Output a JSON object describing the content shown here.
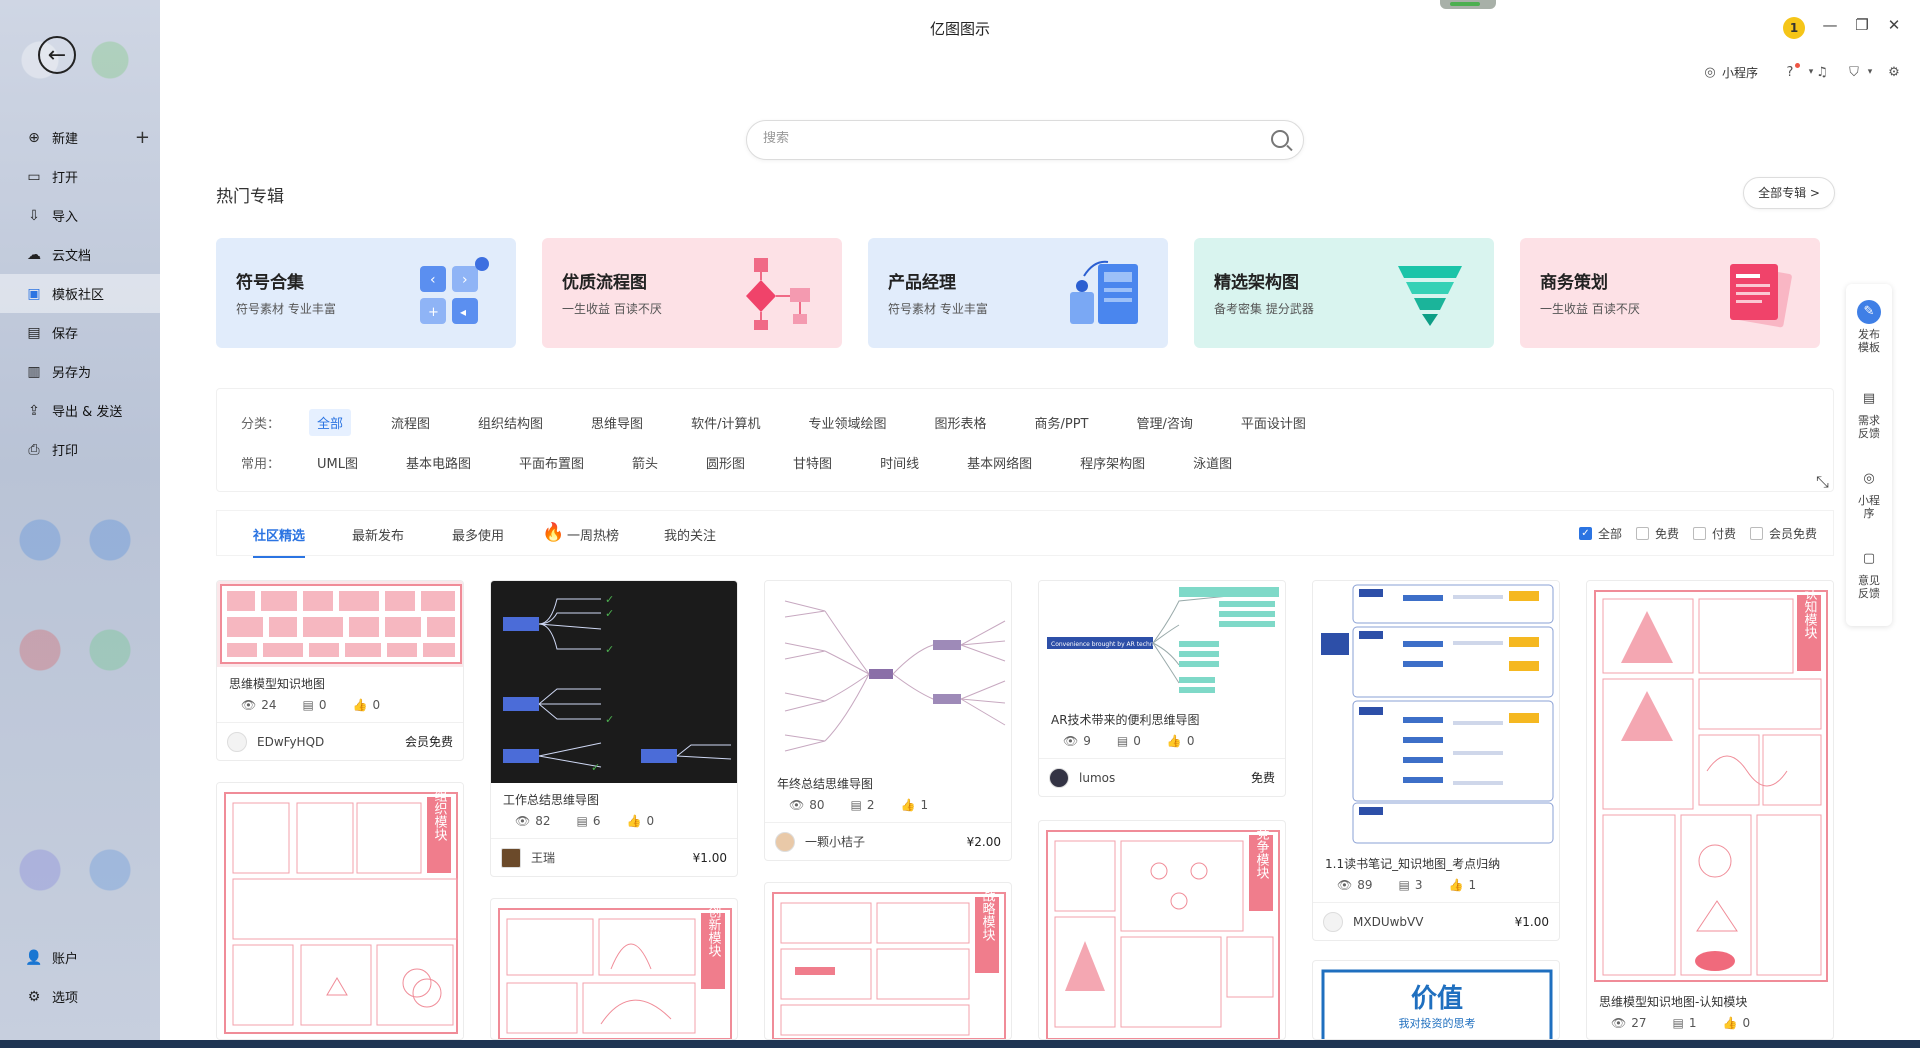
{
  "window": {
    "title": "亿图图示"
  },
  "sidebar": {
    "items": [
      {
        "label": "新建"
      },
      {
        "label": "打开"
      },
      {
        "label": "导入"
      },
      {
        "label": "云文档"
      },
      {
        "label": "模板社区"
      },
      {
        "label": "保存"
      },
      {
        "label": "另存为"
      },
      {
        "label": "导出 & 发送"
      },
      {
        "label": "打印"
      }
    ],
    "bottom": [
      {
        "label": "账户"
      },
      {
        "label": "选项"
      }
    ]
  },
  "toolbar": {
    "mini_program": "小程序",
    "user_badge": "1"
  },
  "search": {
    "placeholder": "搜索"
  },
  "hot": {
    "title": "热门专辑",
    "all_label": "全部专辑 >",
    "cards": [
      {
        "title": "符号合集",
        "subtitle": "符号素材 专业丰富",
        "bg": "#e1ecfb"
      },
      {
        "title": "优质流程图",
        "subtitle": "一生收益 百读不厌",
        "bg": "#fde1e6"
      },
      {
        "title": "产品经理",
        "subtitle": "符号素材 专业丰富",
        "bg": "#e1ecfb"
      },
      {
        "title": "精选架构图",
        "subtitle": "备考密集 提分武器",
        "bg": "#d9f4ef"
      },
      {
        "title": "商务策划",
        "subtitle": "一生收益 百读不厌",
        "bg": "#fde1e6"
      }
    ]
  },
  "categories": {
    "label_main": "分类：",
    "main": [
      "全部",
      "流程图",
      "组织结构图",
      "思维导图",
      "软件/计算机",
      "专业领域绘图",
      "图形表格",
      "商务/PPT",
      "管理/咨询",
      "平面设计图"
    ],
    "label_common": "常用：",
    "common": [
      "UML图",
      "基本电路图",
      "平面布置图",
      "箭头",
      "圆形图",
      "甘特图",
      "时间线",
      "基本网络图",
      "程序架构图",
      "泳道图"
    ]
  },
  "tabs": [
    "社区精选",
    "最新发布",
    "最多使用",
    "一周热榜",
    "我的关注"
  ],
  "filters": [
    "全部",
    "免费",
    "付费",
    "会员免费"
  ],
  "templates": [
    {
      "name": "思维模型知识地图",
      "views": "24",
      "comments": "0",
      "likes": "0",
      "author": "EDwFyHQD",
      "price": "会员免费"
    },
    {
      "name": "工作总结思维导图",
      "views": "82",
      "comments": "6",
      "likes": "0",
      "author": "王瑞",
      "price": "¥1.00"
    },
    {
      "name": "年终总结思维导图",
      "views": "80",
      "comments": "2",
      "likes": "1",
      "author": "一颗小桔子",
      "price": "¥2.00"
    },
    {
      "name": "AR技术带来的便利思维导图",
      "views": "9",
      "comments": "0",
      "likes": "0",
      "author": "lumos",
      "price": "免费"
    },
    {
      "name": "1.1读书笔记_知识地图_考点归纳",
      "views": "89",
      "comments": "3",
      "likes": "1",
      "author": "MXDUwbVV",
      "price": "¥1.00"
    },
    {
      "name": "思维模型知识地图-认知模块",
      "views": "27",
      "comments": "1",
      "likes": "0",
      "author": "",
      "price": ""
    }
  ],
  "thumb_labels": {
    "org": "组织模块",
    "innov": "创新模块",
    "strat": "战略模块",
    "comp": "竞争模块",
    "cog": "认知模块",
    "value_title": "价值",
    "value_sub": "我对投资的思考",
    "ar_heading": "Convenience brought by AR technology"
  },
  "float_panel": [
    "发布模板",
    "需求反馈",
    "小程序",
    "意见反馈"
  ],
  "colors": {
    "accent": "#2b74e2",
    "pink": "#f08c98"
  }
}
